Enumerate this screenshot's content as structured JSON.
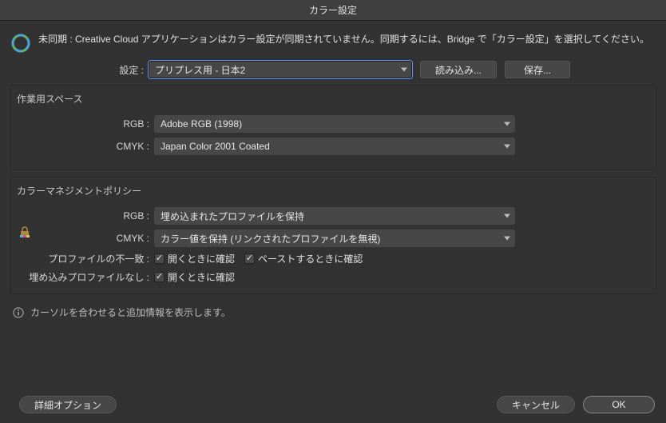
{
  "title": "カラー設定",
  "sync_message": "未同期 : Creative Cloud アプリケーションはカラー設定が同期されていません。同期するには、Bridge で「カラー設定」を選択してください。",
  "settings": {
    "label": "設定 :",
    "value": "プリプレス用 - 日本2",
    "load_btn": "読み込み...",
    "save_btn": "保存..."
  },
  "workspace": {
    "title": "作業用スペース",
    "rgb_label": "RGB :",
    "rgb_value": "Adobe RGB (1998)",
    "cmyk_label": "CMYK :",
    "cmyk_value": "Japan Color 2001 Coated"
  },
  "policy": {
    "title": "カラーマネジメントポリシー",
    "rgb_label": "RGB :",
    "rgb_value": "埋め込まれたプロファイルを保持",
    "cmyk_label": "CMYK :",
    "cmyk_value": "カラー値を保持 (リンクされたプロファイルを無視)",
    "mismatch_label": "プロファイルの不一致 :",
    "mismatch_open": "開くときに確認",
    "mismatch_paste": "ペーストするときに確認",
    "missing_label": "埋め込みプロファイルなし :",
    "missing_open": "開くときに確認"
  },
  "info_text": "カーソルを合わせると追加情報を表示します。",
  "footer": {
    "advanced": "詳細オプション",
    "cancel": "キャンセル",
    "ok": "OK"
  }
}
